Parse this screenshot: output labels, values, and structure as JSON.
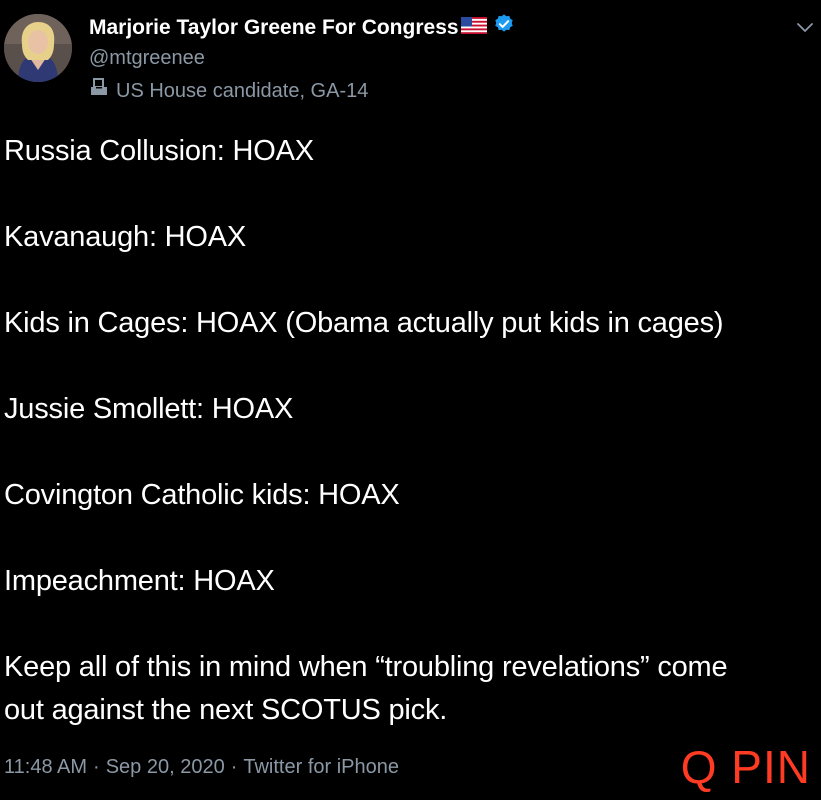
{
  "author": {
    "name": "Marjorie Taylor Greene For Congress",
    "handle": "@mtgreenee",
    "label": "US House candidate, GA-14",
    "flag_icon": "us-flag-icon",
    "verified_icon": "verified-badge-icon",
    "label_icon": "ballot-box-icon",
    "verified_color": "#1d9bf0"
  },
  "tweet": {
    "lines": [
      "Russia Collusion: HOAX",
      "Kavanaugh: HOAX",
      "Kids in Cages: HOAX (Obama actually put kids in cages)",
      "Jussie Smollett: HOAX",
      "Covington Catholic kids: HOAX",
      "Impeachment: HOAX",
      "Keep all of this in mind when “troubling revelations” come",
      "out against the next SCOTUS pick."
    ]
  },
  "meta": {
    "time": "11:48 AM",
    "date": "Sep 20, 2020",
    "source": "Twitter for iPhone",
    "separator": "·"
  },
  "overlay": {
    "watermark": "Q PIN",
    "color": "#ff3b24"
  },
  "colors": {
    "background": "#000000",
    "text": "#ffffff",
    "secondary": "#8b98a5"
  }
}
